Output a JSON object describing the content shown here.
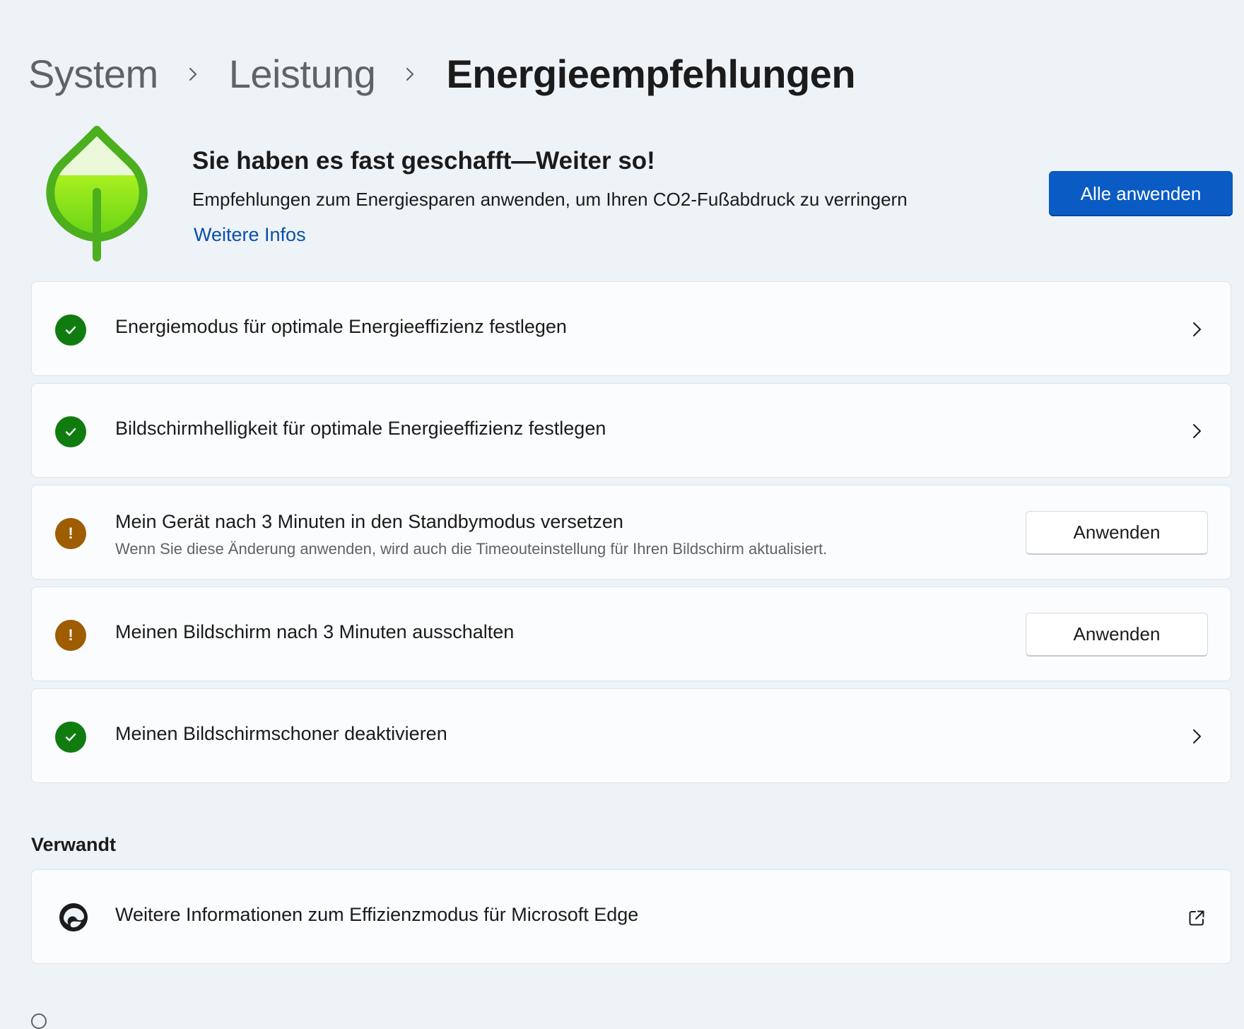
{
  "breadcrumb": {
    "items": [
      "System",
      "Leistung",
      "Energieempfehlungen"
    ],
    "separator_icon": "chevron-right-icon"
  },
  "hero": {
    "icon": "leaf-icon",
    "title": "Sie haben es fast geschafft—Weiter so!",
    "description": "Empfehlungen zum Energiesparen anwenden, um Ihren CO2-Fußabdruck zu verringern",
    "link_label": "Weitere Infos",
    "apply_all_label": "Alle anwenden",
    "accent_color": "#0a5bc4",
    "leaf_colors": [
      "#4caf1e",
      "#a8f020"
    ]
  },
  "recommendations": [
    {
      "status": "ok",
      "status_icon": "checkmark-icon",
      "title": "Energiemodus für optimale Energieeffizienz festlegen",
      "subtitle": "",
      "action": "chevron"
    },
    {
      "status": "ok",
      "status_icon": "checkmark-icon",
      "title": "Bildschirmhelligkeit für optimale Energieeffizienz festlegen",
      "subtitle": "",
      "action": "chevron"
    },
    {
      "status": "warning",
      "status_icon": "warning-icon",
      "status_mark": "!",
      "title": "Mein Gerät nach 3 Minuten in den Standbymodus versetzen",
      "subtitle": "Wenn Sie diese Änderung anwenden, wird auch die Timeouteinstellung für Ihren Bildschirm aktualisiert.",
      "action": "button",
      "button_label": "Anwenden"
    },
    {
      "status": "warning",
      "status_icon": "warning-icon",
      "status_mark": "!",
      "title": "Meinen Bildschirm nach 3 Minuten ausschalten",
      "subtitle": "",
      "action": "button",
      "button_label": "Anwenden"
    },
    {
      "status": "ok",
      "status_icon": "checkmark-icon",
      "title": "Meinen Bildschirmschoner deaktivieren",
      "subtitle": "",
      "action": "chevron"
    }
  ],
  "status_colors": {
    "ok": "#107c10",
    "warning": "#9d5d00"
  },
  "related": {
    "heading": "Verwandt",
    "items": [
      {
        "icon": "edge-icon",
        "title": "Weitere Informationen zum Effizienzmodus für Microsoft Edge",
        "action_icon": "open-external-icon"
      }
    ]
  }
}
